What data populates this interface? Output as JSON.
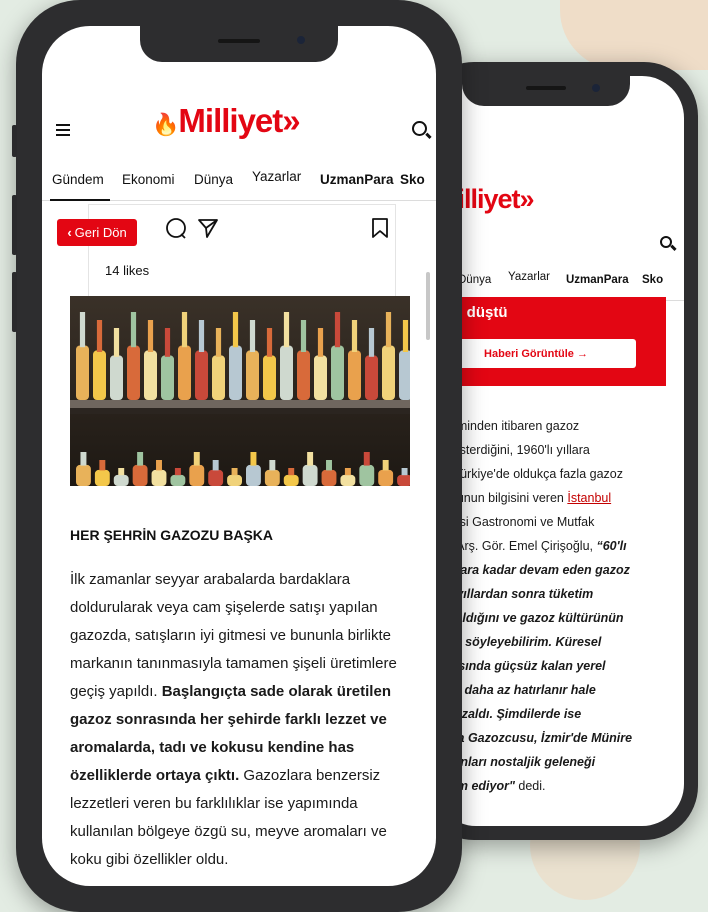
{
  "site": {
    "brand_name": "Milliyet",
    "brand_suffix": "»",
    "flame": "🔥"
  },
  "nav": {
    "front_items": [
      "Gündem",
      "Ekonomi",
      "Dünya",
      "Yazarlar",
      "UzmanPara",
      "Sko"
    ],
    "back_items": [
      "i",
      "Dünya",
      "Yazarlar",
      "UzmanPara",
      "Sko"
    ]
  },
  "front": {
    "back_button_label": "Geri Dön",
    "likes": "14 likes",
    "article_heading": "HER ŞEHRİN GAZOZU BAŞKA",
    "paragraph": {
      "part1": "İlk zamanlar seyyar arabalarda bardaklara doldurularak veya cam şişelerde satışı yapılan gazozda, satışların iyi gitmesi ve bununla birlikte markanın tanınmasıyla tamamen şişeli üretimlere geçiş yapıldı. ",
      "bold": "Başlangıçta sade olarak üretilen gazoz sonrasında her şehirde farklı lezzet ve aromalarda, tadı ve kokusu kendine has özelliklerde ortaya çıktı.",
      "part2": " Gazozlara benzersiz lezzetleri veren bu farklılıklar ise yapımında kullanılan bölgeye özgü su, meyve aromaları ve koku gibi özellikler oldu."
    }
  },
  "back": {
    "red_title": "pol düştü",
    "red_button": "Haberi Görüntüle →",
    "lines": [
      {
        "t": "öneminden itibaren gazoz"
      },
      {
        "t": "ş gösterdiğini, 1960'lı yıllara"
      },
      {
        "t": "se Türkiye'de oldukça fazla gazoz"
      },
      {
        "t": "duğunun bilgisini veren ",
        "link": "İstanbul"
      },
      {
        "t": "rsitesi Gastronomi ve Mutfak"
      },
      {
        "t": "mü Arş. Gör. Emel Çirişoğlu, ",
        "bold": "“60'lı"
      },
      {
        "bold": "i yıllara kadar devam eden gazoz"
      },
      {
        "bold": "0'li yıllardan sonra tüketim"
      },
      {
        "bold": "daraldığını ve gazoz kültürünün"
      },
      {
        "bold": "iğini söyleyebilirim. Küresel"
      },
      {
        "bold": "arşısında güçsüz kalan yerel"
      },
      {
        "bold": "anla daha az hatırlanır hale"
      },
      {
        "bold": "arı azaldı. Şimdilerde ise"
      },
      {
        "bold": "evda Gazozcusu, İzmir'de Münire"
      },
      {
        "bold": "ikkanları nostaljik geleneği"
      },
      {
        "bold": "evam ediyor\"",
        "t_after": " dedi."
      }
    ]
  },
  "colors": {
    "brand_red": "#e30613",
    "frame": "#2d2d2f",
    "background": "#e3ece3"
  },
  "icons": [
    "menu-icon",
    "search-icon",
    "comment-icon",
    "share-icon",
    "bookmark-icon",
    "chevron-left-icon",
    "arrow-right-icon"
  ]
}
